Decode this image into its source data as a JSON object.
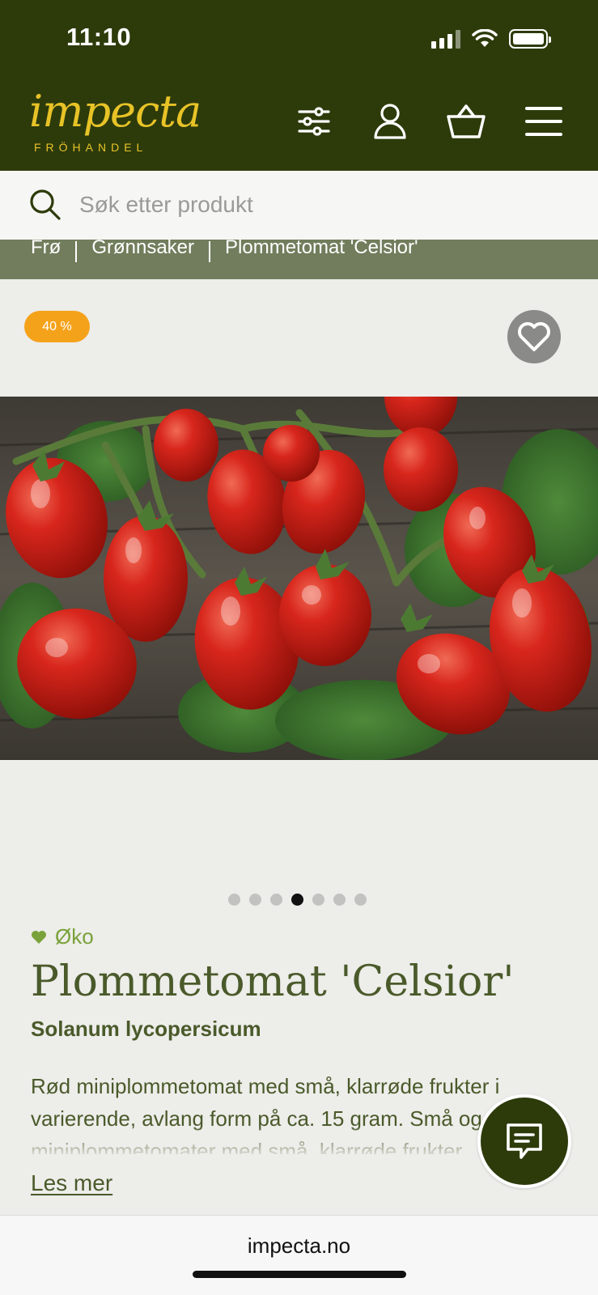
{
  "status_bar": {
    "time": "11:10"
  },
  "header": {
    "logo_word": "impecta",
    "logo_sub": "FRÖHANDEL",
    "icons": [
      "filter-icon",
      "user-icon",
      "basket-icon",
      "menu-icon"
    ]
  },
  "search": {
    "placeholder": "Søk etter produkt",
    "value": ""
  },
  "breadcrumb": {
    "items": [
      "Frø",
      "Grønnsaker",
      "Plommetomat 'Celsior'"
    ]
  },
  "product": {
    "discount_badge": "40 %",
    "gallery": {
      "total_images": 7,
      "active_index": 3
    },
    "eco_label": "Øko",
    "title": "Plommetomat 'Celsior'",
    "latin_name": "Solanum lycopersicum",
    "description": "Rød miniplommetomat med små, klarrøde frukter i varierende, avlang form på ca. 15 gram. Små og saftige miniplommetomater med små, klarrøde frukter.",
    "read_more": "Les mer"
  },
  "browser": {
    "url": "impecta.no"
  },
  "colors": {
    "header_bg": "#2d3b0b",
    "logo_yellow": "#e8c327",
    "breadcrumb_bg": "#717d5c",
    "badge_orange": "#f5a21b",
    "text_olive": "#4a5a2a",
    "eco_green": "#7aa23a",
    "page_bg": "#ededea"
  }
}
